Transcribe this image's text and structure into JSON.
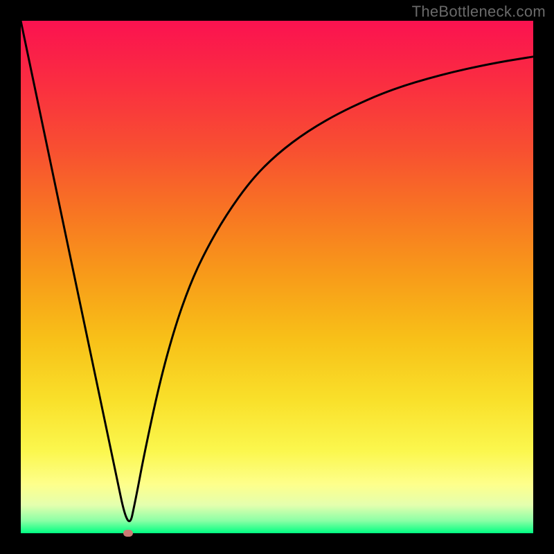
{
  "watermark": "TheBottleneck.com",
  "colors": {
    "frame": "#000000",
    "curve": "#000000",
    "marker": "#cb7a74",
    "gradient_stops": [
      {
        "offset": 0.0,
        "color": "#fb1250"
      },
      {
        "offset": 0.12,
        "color": "#fa2d41"
      },
      {
        "offset": 0.25,
        "color": "#f84f31"
      },
      {
        "offset": 0.38,
        "color": "#f87722"
      },
      {
        "offset": 0.5,
        "color": "#f89c19"
      },
      {
        "offset": 0.62,
        "color": "#f8c018"
      },
      {
        "offset": 0.74,
        "color": "#f9e02a"
      },
      {
        "offset": 0.84,
        "color": "#fbf74e"
      },
      {
        "offset": 0.905,
        "color": "#feff8c"
      },
      {
        "offset": 0.945,
        "color": "#e4ffae"
      },
      {
        "offset": 0.975,
        "color": "#8dffa6"
      },
      {
        "offset": 1.0,
        "color": "#00ff82"
      }
    ]
  },
  "chart_data": {
    "type": "line",
    "title": "",
    "xlabel": "",
    "ylabel": "",
    "xlim": [
      0,
      100
    ],
    "ylim": [
      0,
      100
    ],
    "grid": false,
    "legend": false,
    "minimum_marker": {
      "x": 21,
      "y": 0
    },
    "series": [
      {
        "name": "curve",
        "x": [
          0,
          3,
          6,
          9,
          12,
          15,
          18,
          21,
          22.5,
          24,
          27,
          30,
          33,
          36,
          40,
          45,
          50,
          56,
          63,
          72,
          82,
          92,
          100
        ],
        "y": [
          100,
          85.7,
          71.4,
          57.1,
          42.8,
          28.6,
          14.3,
          0,
          7,
          15,
          29,
          40,
          48.5,
          55,
          62,
          69,
          74,
          78.5,
          82.5,
          86.5,
          89.5,
          91.7,
          93
        ]
      }
    ]
  }
}
